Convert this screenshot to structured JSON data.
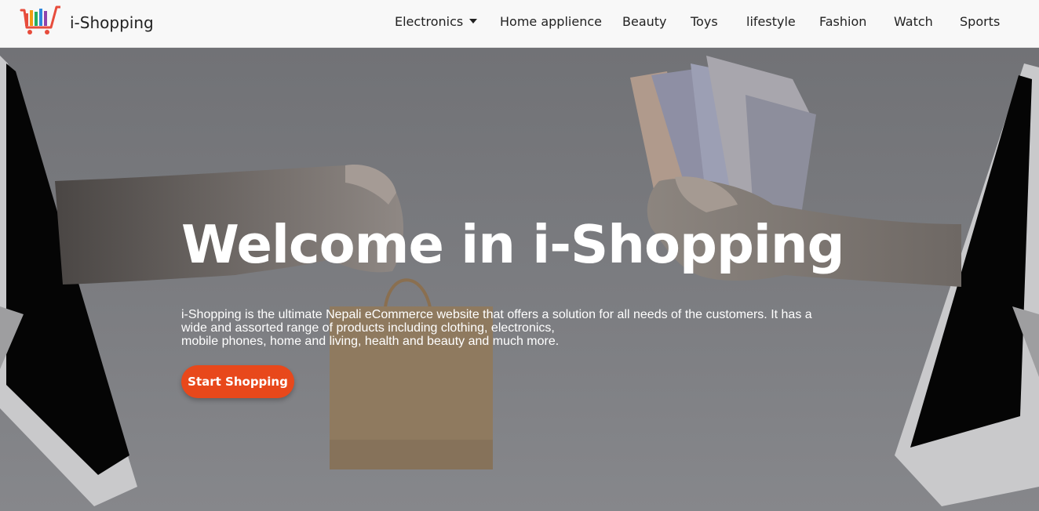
{
  "brand": {
    "name": "i-Shopping",
    "logo_icon": "shopping-cart-logo-icon"
  },
  "nav": {
    "items": [
      {
        "label": "Electronics",
        "has_dropdown": true
      },
      {
        "label": "Home applience"
      },
      {
        "label": "Beauty"
      },
      {
        "label": "Toys"
      },
      {
        "label": "lifestyle"
      },
      {
        "label": "Fashion"
      },
      {
        "label": "Watch"
      },
      {
        "label": "Sports"
      }
    ]
  },
  "hero": {
    "title": "Welcome in i-Shopping",
    "description_lines": [
      "i-Shopping is the ultimate Nepali eCommerce website that offers a solution for all needs of the customers. It has a",
      "wide and assorted range of products including clothing, electronics,",
      "mobile phones, home and living, health and beauty and much more."
    ],
    "cta_label": "Start Shopping"
  },
  "colors": {
    "accent": "#e8481b",
    "navbar_bg": "#f8f8f8",
    "hero_text": "#ffffff"
  }
}
